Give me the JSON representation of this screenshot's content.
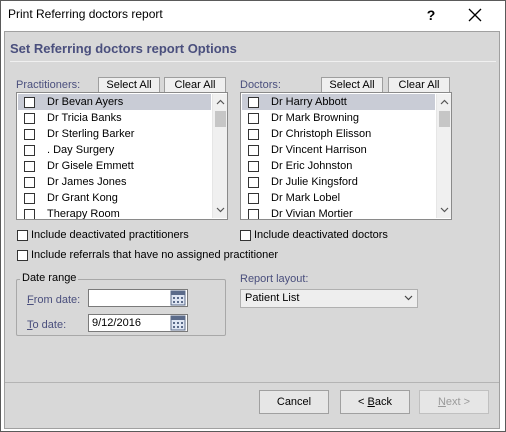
{
  "window": {
    "title": "Print Referring doctors report",
    "help_label": "?"
  },
  "heading": "Set Referring doctors report Options",
  "practitioners": {
    "label": "Practitioners:",
    "select_all_label": "Select All",
    "clear_all_label": "Clear All",
    "items": [
      {
        "label": "Dr Bevan Ayers",
        "checked": false,
        "selected": true
      },
      {
        "label": "Dr Tricia Banks",
        "checked": false
      },
      {
        "label": "Dr Sterling Barker",
        "checked": false
      },
      {
        "label": ". Day Surgery",
        "checked": false
      },
      {
        "label": "Dr Gisele Emmett",
        "checked": false
      },
      {
        "label": "Dr James Jones",
        "checked": false
      },
      {
        "label": "Dr Grant Kong",
        "checked": false
      },
      {
        "label": "Therapy Room",
        "checked": false
      }
    ]
  },
  "doctors": {
    "label": "Doctors:",
    "select_all_label": "Select All",
    "clear_all_label": "Clear All",
    "items": [
      {
        "label": "Dr Harry Abbott",
        "checked": false,
        "selected": true
      },
      {
        "label": "Dr Mark Browning",
        "checked": false
      },
      {
        "label": "Dr Christoph Elisson",
        "checked": false
      },
      {
        "label": "Dr Vincent Harrison",
        "checked": false
      },
      {
        "label": "Dr Eric Johnston",
        "checked": false
      },
      {
        "label": "Dr Julie Kingsford",
        "checked": false
      },
      {
        "label": "Dr Mark Lobel",
        "checked": false
      },
      {
        "label": "Dr Vivian Mortier",
        "checked": false
      }
    ]
  },
  "options": {
    "include_deactivated_practitioners": "Include deactivated practitioners",
    "include_deactivated_doctors": "Include deactivated doctors",
    "include_no_practitioner": "Include referrals that have no assigned practitioner"
  },
  "date_range": {
    "title": "Date range",
    "from_label": "From date:",
    "from_value": "",
    "to_label": "To date:",
    "to_value": "9/12/2016"
  },
  "report_layout": {
    "label": "Report layout:",
    "selected": "Patient List"
  },
  "footer": {
    "cancel_label": "Cancel",
    "back_label": "< Back",
    "next_label": "Next >"
  },
  "colors": {
    "heading": "#4a4f7d",
    "client_bg": "#d8d8d8",
    "selection": "#c9ccd6"
  }
}
